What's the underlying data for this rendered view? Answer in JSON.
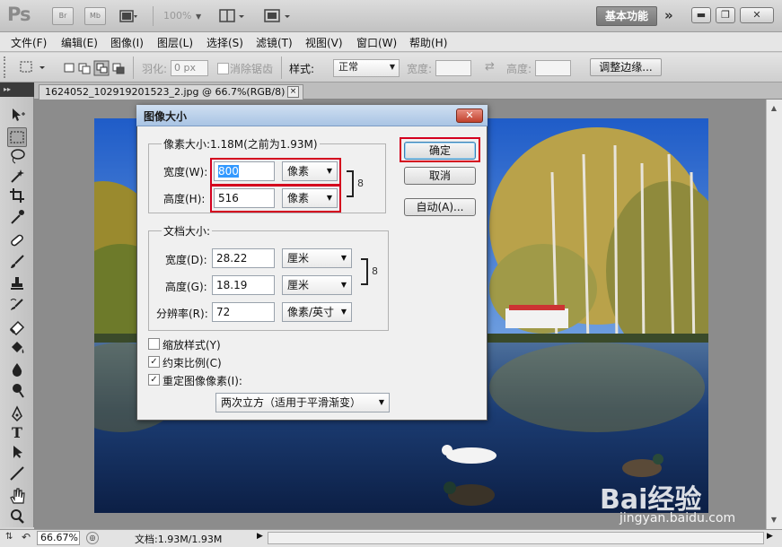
{
  "titlebar": {
    "logo": "Ps",
    "bridge_btn": "Br",
    "minibridge_btn": "Mb",
    "zoom_value": "100%",
    "workspace": "基本功能",
    "more": "»"
  },
  "menubar": {
    "items": [
      "文件(F)",
      "编辑(E)",
      "图像(I)",
      "图层(L)",
      "选择(S)",
      "滤镜(T)",
      "视图(V)",
      "窗口(W)",
      "帮助(H)"
    ]
  },
  "options": {
    "feather_label": "羽化:",
    "feather_value": "0 px",
    "antialias_label": "消除锯齿",
    "style_label": "样式:",
    "style_value": "正常",
    "width_label": "宽度:",
    "height_label": "高度:",
    "refine_edge": "调整边缘..."
  },
  "document": {
    "tab_title": "1624052_102919201523_2.jpg @ 66.7%(RGB/8)",
    "tab_close": "×"
  },
  "statusbar": {
    "zoom": "66.67%",
    "doc_info": "文档:1.93M/1.93M"
  },
  "dialog": {
    "title": "图像大小",
    "close": "✕",
    "pixel_group": "像素大小:1.18M(之前为1.93M)",
    "pixel_width_label": "宽度(W):",
    "pixel_width_value": "800",
    "pixel_width_unit": "像素",
    "pixel_height_label": "高度(H):",
    "pixel_height_value": "516",
    "pixel_height_unit": "像素",
    "doc_group": "文档大小:",
    "doc_width_label": "宽度(D):",
    "doc_width_value": "28.22",
    "doc_width_unit": "厘米",
    "doc_height_label": "高度(G):",
    "doc_height_value": "18.19",
    "doc_height_unit": "厘米",
    "resolution_label": "分辨率(R):",
    "resolution_value": "72",
    "resolution_unit": "像素/英寸",
    "scale_styles": "缩放样式(Y)",
    "constrain": "约束比例(C)",
    "resample": "重定图像像素(I):",
    "resample_method": "两次立方（适用于平滑渐变）",
    "ok": "确定",
    "cancel": "取消",
    "auto": "自动(A)...",
    "checks": {
      "scale_styles": false,
      "constrain": true,
      "resample": true
    }
  },
  "watermark": {
    "brand": "Bai经验",
    "url": "jingyan.baidu.com"
  },
  "colors": {
    "highlight": "#d4001e",
    "dialog_bg": "#f0f0f0",
    "title_gradient_top": "#cfdff1"
  }
}
